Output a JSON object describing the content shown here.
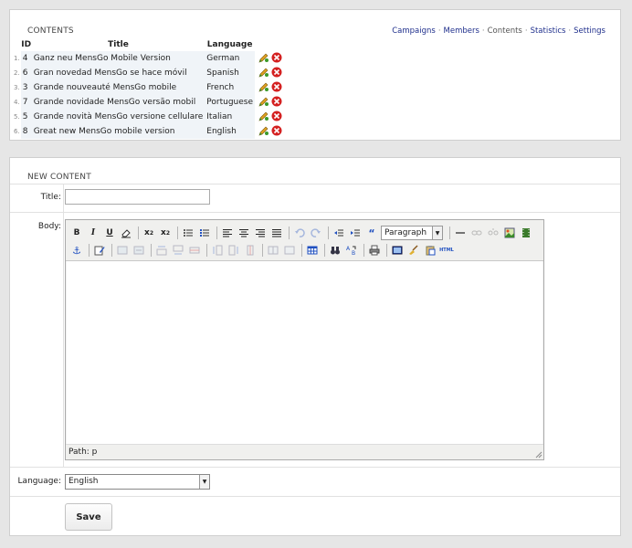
{
  "contents": {
    "title": "CONTENTS",
    "nav": [
      {
        "label": "Campaigns",
        "link": true
      },
      {
        "label": "Members",
        "link": true
      },
      {
        "label": "Contents",
        "link": false
      },
      {
        "label": "Statistics",
        "link": true
      },
      {
        "label": "Settings",
        "link": true
      }
    ],
    "columns": {
      "id": "ID",
      "title": "Title",
      "language": "Language"
    },
    "rows": [
      {
        "num": "1.",
        "id": "4",
        "title": "Ganz neu MensGo Mobile Version",
        "language": "German"
      },
      {
        "num": "2.",
        "id": "6",
        "title": "Gran novedad MensGo se hace móvil",
        "language": "Spanish"
      },
      {
        "num": "3.",
        "id": "3",
        "title": "Grande nouveauté MensGo mobile",
        "language": "French"
      },
      {
        "num": "4.",
        "id": "7",
        "title": "Grande novidade MensGo versão mobil",
        "language": "Portuguese"
      },
      {
        "num": "5.",
        "id": "5",
        "title": "Grande novità MensGo versione cellulare",
        "language": "Italian"
      },
      {
        "num": "6.",
        "id": "8",
        "title": "Great new MensGo mobile version",
        "language": "English"
      }
    ]
  },
  "new_content": {
    "title": "NEW CONTENT",
    "title_label": "Title:",
    "title_value": "",
    "body_label": "Body:",
    "format_value": "Paragraph",
    "path_text": "Path: p",
    "language_label": "Language:",
    "language_value": "English",
    "save_label": "Save"
  },
  "colors": {
    "link": "#1f2f8c",
    "edit_icon": "#e0a020",
    "delete_icon": "#d42020"
  }
}
